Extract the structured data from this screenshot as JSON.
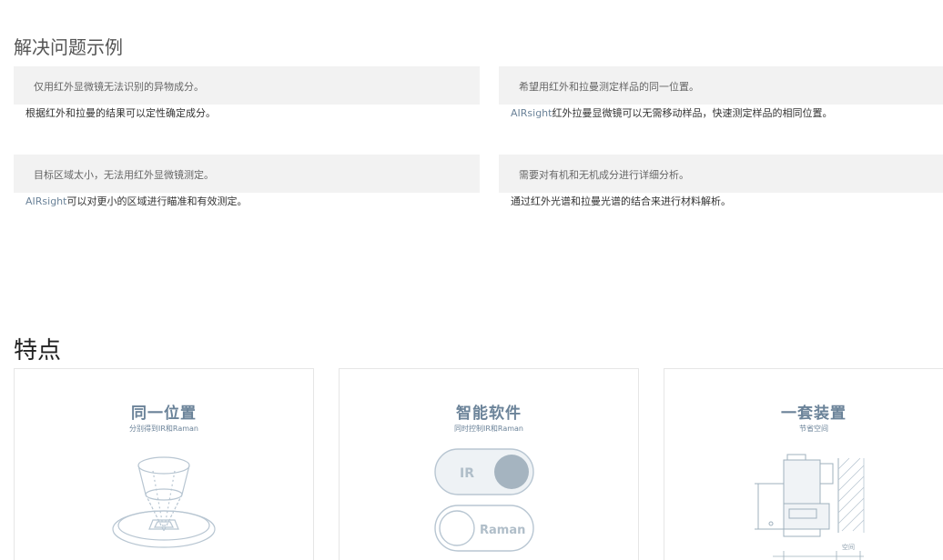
{
  "examples": {
    "title": "解决问题示例",
    "items": [
      {
        "problem": "仅用红外显微镜无法识别的异物成分。",
        "solution_prefix": "",
        "solution": "根据红外和拉曼的结果可以定性确定成分。"
      },
      {
        "problem": "希望用红外和拉曼测定样品的同一位置。",
        "solution_prefix": "AIRsight",
        "solution": "红外拉曼显微镜可以无需移动样品，快速测定样品的相同位置。"
      },
      {
        "problem": "目标区域太小，无法用红外显微镜测定。",
        "solution_prefix": "AIRsight",
        "solution": "可以对更小的区域进行瞄准和有效测定。"
      },
      {
        "problem": "需要对有机和无机成分进行详细分析。",
        "solution_prefix": "",
        "solution": "通过红外光谱和拉曼光谱的结合来进行材料解析。"
      }
    ]
  },
  "features": {
    "title": "特点",
    "cards": [
      {
        "title": "同一位置",
        "subtitle": "分别得到IR和Raman"
      },
      {
        "title": "智能软件",
        "subtitle": "同时控制IR和Raman",
        "toggle_ir": "IR",
        "toggle_raman": "Raman"
      },
      {
        "title": "一套装置",
        "subtitle": "节省空间",
        "space_label": "空间"
      }
    ]
  },
  "colors": {
    "accent": "#6b8399",
    "card_head_bg": "#f2f2f2",
    "border": "#e6e6e6"
  }
}
